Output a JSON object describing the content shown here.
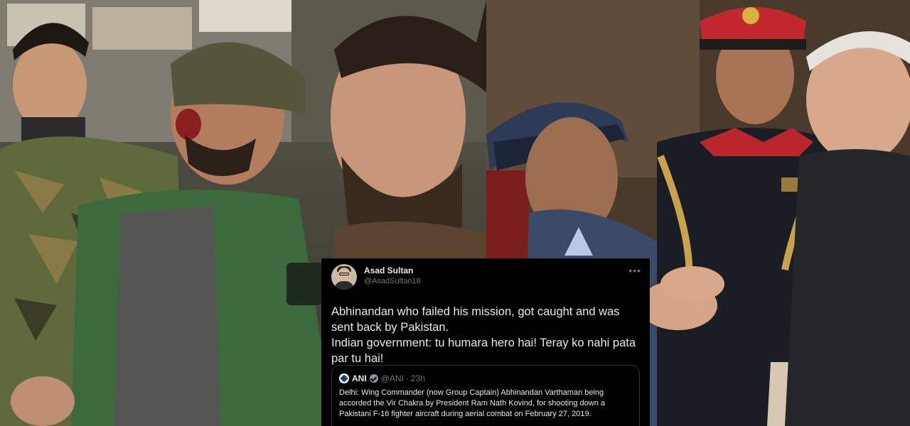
{
  "tweet": {
    "user": {
      "name": "Asad Sultan",
      "handle": "@AsadSultan18"
    },
    "more_icon": "more-horizontal-icon",
    "text_lines": [
      "Abhinandan who failed his mission, got caught and was sent back by Pakistan.",
      "Indian government: tu humara hero hai! Teray ko nahi pata par tu hai!"
    ],
    "quote": {
      "name": "ANI",
      "verified_icon": "verified-badge-icon",
      "handle": "@ANI",
      "dot": "·",
      "time": "23h",
      "text": "Delhi: Wing Commander (now Group Captain) Abhinandan Varthaman being accorded the Vir Chakra by President Ram Nath Kovind, for shooting down a Pakistani F-16 fighter aircraft during aerial combat on February 27, 2019."
    }
  },
  "colors": {
    "tweet_bg": "#000000",
    "text": "#e7e9ea",
    "muted": "#71767b",
    "border": "#2f3336"
  }
}
